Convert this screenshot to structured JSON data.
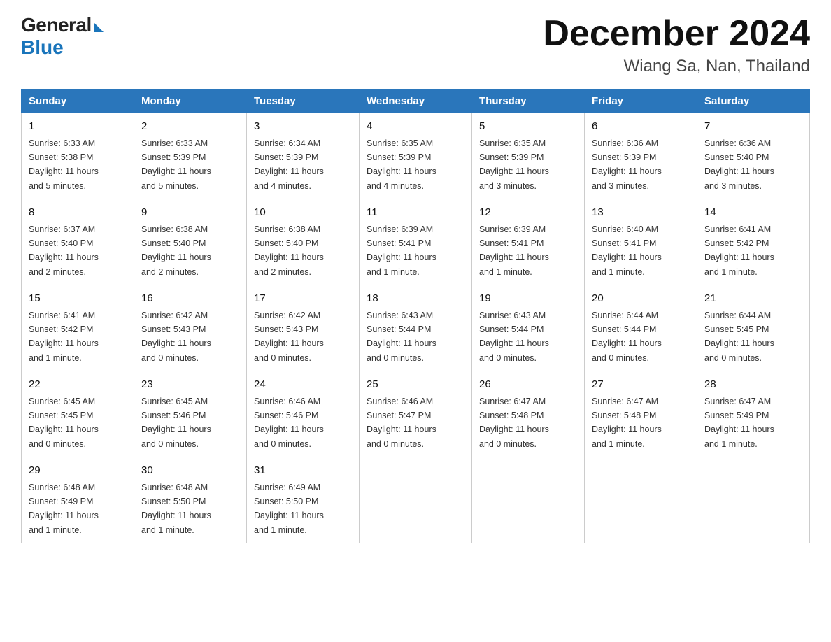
{
  "header": {
    "logo_general": "General",
    "logo_blue": "Blue",
    "month_title": "December 2024",
    "location": "Wiang Sa, Nan, Thailand"
  },
  "weekdays": [
    "Sunday",
    "Monday",
    "Tuesday",
    "Wednesday",
    "Thursday",
    "Friday",
    "Saturday"
  ],
  "weeks": [
    [
      {
        "day": "1",
        "sunrise": "6:33 AM",
        "sunset": "5:38 PM",
        "daylight": "11 hours and 5 minutes."
      },
      {
        "day": "2",
        "sunrise": "6:33 AM",
        "sunset": "5:39 PM",
        "daylight": "11 hours and 5 minutes."
      },
      {
        "day": "3",
        "sunrise": "6:34 AM",
        "sunset": "5:39 PM",
        "daylight": "11 hours and 4 minutes."
      },
      {
        "day": "4",
        "sunrise": "6:35 AM",
        "sunset": "5:39 PM",
        "daylight": "11 hours and 4 minutes."
      },
      {
        "day": "5",
        "sunrise": "6:35 AM",
        "sunset": "5:39 PM",
        "daylight": "11 hours and 3 minutes."
      },
      {
        "day": "6",
        "sunrise": "6:36 AM",
        "sunset": "5:39 PM",
        "daylight": "11 hours and 3 minutes."
      },
      {
        "day": "7",
        "sunrise": "6:36 AM",
        "sunset": "5:40 PM",
        "daylight": "11 hours and 3 minutes."
      }
    ],
    [
      {
        "day": "8",
        "sunrise": "6:37 AM",
        "sunset": "5:40 PM",
        "daylight": "11 hours and 2 minutes."
      },
      {
        "day": "9",
        "sunrise": "6:38 AM",
        "sunset": "5:40 PM",
        "daylight": "11 hours and 2 minutes."
      },
      {
        "day": "10",
        "sunrise": "6:38 AM",
        "sunset": "5:40 PM",
        "daylight": "11 hours and 2 minutes."
      },
      {
        "day": "11",
        "sunrise": "6:39 AM",
        "sunset": "5:41 PM",
        "daylight": "11 hours and 1 minute."
      },
      {
        "day": "12",
        "sunrise": "6:39 AM",
        "sunset": "5:41 PM",
        "daylight": "11 hours and 1 minute."
      },
      {
        "day": "13",
        "sunrise": "6:40 AM",
        "sunset": "5:41 PM",
        "daylight": "11 hours and 1 minute."
      },
      {
        "day": "14",
        "sunrise": "6:41 AM",
        "sunset": "5:42 PM",
        "daylight": "11 hours and 1 minute."
      }
    ],
    [
      {
        "day": "15",
        "sunrise": "6:41 AM",
        "sunset": "5:42 PM",
        "daylight": "11 hours and 1 minute."
      },
      {
        "day": "16",
        "sunrise": "6:42 AM",
        "sunset": "5:43 PM",
        "daylight": "11 hours and 0 minutes."
      },
      {
        "day": "17",
        "sunrise": "6:42 AM",
        "sunset": "5:43 PM",
        "daylight": "11 hours and 0 minutes."
      },
      {
        "day": "18",
        "sunrise": "6:43 AM",
        "sunset": "5:44 PM",
        "daylight": "11 hours and 0 minutes."
      },
      {
        "day": "19",
        "sunrise": "6:43 AM",
        "sunset": "5:44 PM",
        "daylight": "11 hours and 0 minutes."
      },
      {
        "day": "20",
        "sunrise": "6:44 AM",
        "sunset": "5:44 PM",
        "daylight": "11 hours and 0 minutes."
      },
      {
        "day": "21",
        "sunrise": "6:44 AM",
        "sunset": "5:45 PM",
        "daylight": "11 hours and 0 minutes."
      }
    ],
    [
      {
        "day": "22",
        "sunrise": "6:45 AM",
        "sunset": "5:45 PM",
        "daylight": "11 hours and 0 minutes."
      },
      {
        "day": "23",
        "sunrise": "6:45 AM",
        "sunset": "5:46 PM",
        "daylight": "11 hours and 0 minutes."
      },
      {
        "day": "24",
        "sunrise": "6:46 AM",
        "sunset": "5:46 PM",
        "daylight": "11 hours and 0 minutes."
      },
      {
        "day": "25",
        "sunrise": "6:46 AM",
        "sunset": "5:47 PM",
        "daylight": "11 hours and 0 minutes."
      },
      {
        "day": "26",
        "sunrise": "6:47 AM",
        "sunset": "5:48 PM",
        "daylight": "11 hours and 0 minutes."
      },
      {
        "day": "27",
        "sunrise": "6:47 AM",
        "sunset": "5:48 PM",
        "daylight": "11 hours and 1 minute."
      },
      {
        "day": "28",
        "sunrise": "6:47 AM",
        "sunset": "5:49 PM",
        "daylight": "11 hours and 1 minute."
      }
    ],
    [
      {
        "day": "29",
        "sunrise": "6:48 AM",
        "sunset": "5:49 PM",
        "daylight": "11 hours and 1 minute."
      },
      {
        "day": "30",
        "sunrise": "6:48 AM",
        "sunset": "5:50 PM",
        "daylight": "11 hours and 1 minute."
      },
      {
        "day": "31",
        "sunrise": "6:49 AM",
        "sunset": "5:50 PM",
        "daylight": "11 hours and 1 minute."
      },
      null,
      null,
      null,
      null
    ]
  ],
  "labels": {
    "sunrise": "Sunrise:",
    "sunset": "Sunset:",
    "daylight": "Daylight:"
  }
}
